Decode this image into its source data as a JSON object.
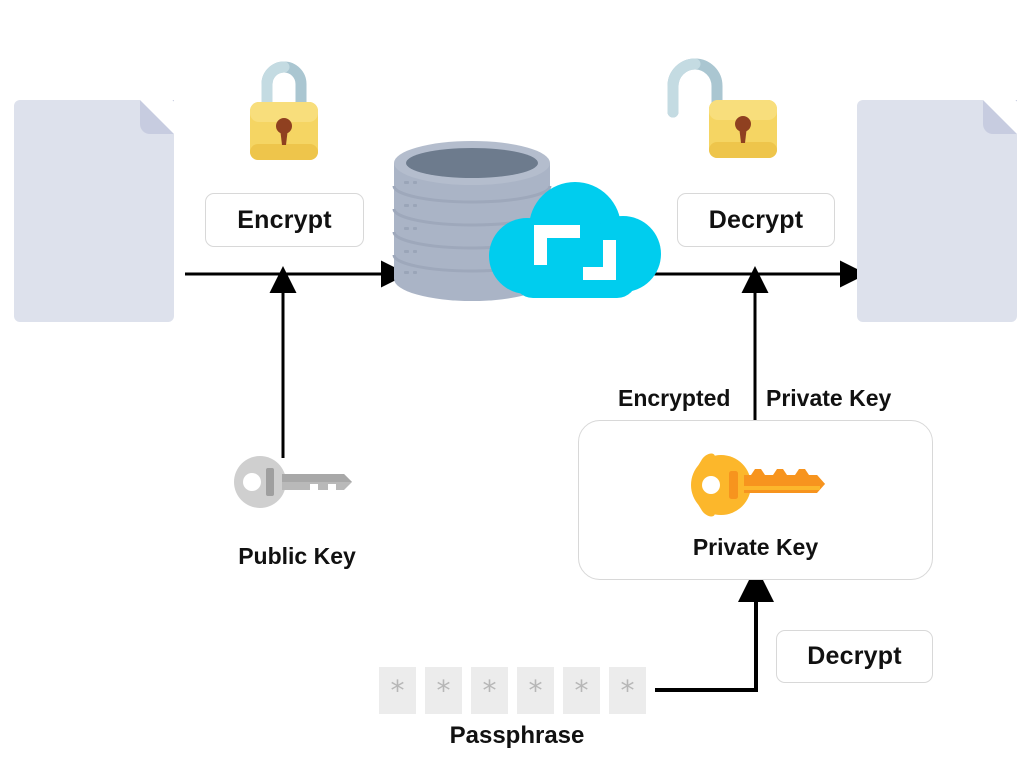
{
  "diagram": {
    "title": "Public key encryption and private key decryption flow",
    "colors": {
      "document": "#dde1ec",
      "document_fold": "#c7cce0",
      "cloud": "#00cdee",
      "database": "#aab4c6",
      "database_top": "#6d7b8d",
      "lock_body": "#f5d563",
      "lock_shackle": "#aac6d1",
      "lock_keyhole": "#8f4020",
      "public_key": "#c7c7c7",
      "private_key": "#fcb72b",
      "private_key_blade": "#f7941e",
      "passphrase_cell": "#ececec",
      "line": "#000000",
      "border": "#d8d8d8",
      "background": "#ffffff"
    },
    "nodes": {
      "source_document": {
        "name": "Plaintext document"
      },
      "encrypt_button": {
        "label": "Encrypt"
      },
      "closed_lock": {
        "name": "closed-padlock"
      },
      "storage": {
        "name": "Cloud database storage"
      },
      "open_lock": {
        "name": "open-padlock"
      },
      "decrypt_button": {
        "label": "Decrypt"
      },
      "target_document": {
        "name": "Decrypted document"
      },
      "public_key": {
        "label": "Public Key"
      },
      "encrypted_private_key": {
        "label_left": "Encrypted",
        "label_right": "Private Key"
      },
      "private_key_card": {
        "label": "Private Key"
      },
      "passphrase": {
        "label": "Passphrase",
        "masked_value": "******",
        "cells": [
          "*",
          "*",
          "*",
          "*",
          "*",
          "*"
        ]
      },
      "decrypt_key_button": {
        "label": "Decrypt"
      }
    },
    "flow_steps": [
      "Document → Encrypt (with Public Key) → Cloud database",
      "Cloud database → Decrypt (with Private Key) → Document",
      "Passphrase → Decrypt → Encrypted Private Key"
    ]
  }
}
